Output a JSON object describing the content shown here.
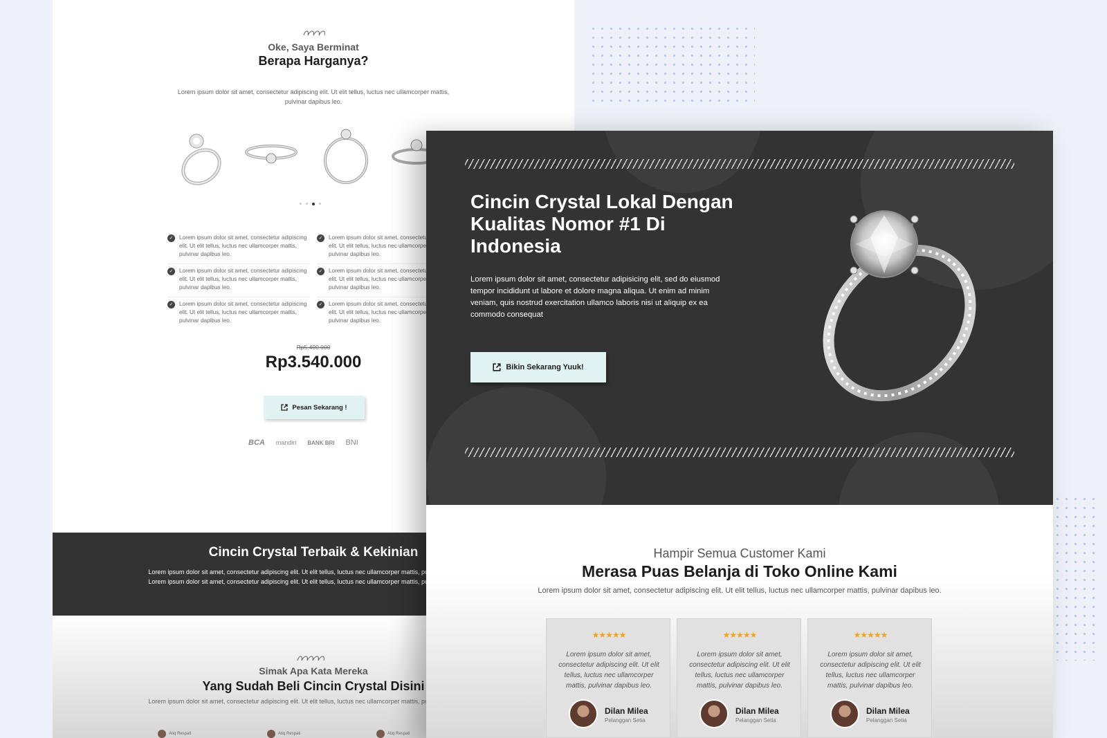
{
  "back_page": {
    "pricing_section": {
      "subtitle": "Oke, Saya Berminat",
      "title": "Berapa Harganya?",
      "description": "Lorem ipsum dolor sit amet, consectetur adipiscing elit. Ut elit tellus, luctus nec ullamcorper mattis, pulvinar dapibus leo.",
      "carousel_active_index": 2,
      "carousel_dot_count": 4,
      "features": [
        "Lorem ipsum dolor sit amet, consectetur adipiscing elit. Ut elit tellus, luctus nec ullamcorper mattis, pulvinar dapibus leo.",
        "Lorem ipsum dolor sit amet, consectetur adipiscing elit. Ut elit tellus, luctus nec ullamcorper mattis, pulvinar dapibus leo.",
        "Lorem ipsum dolor sit amet, consectetur adipiscing elit. Ut elit tellus, luctus nec ullamcorper mattis, pulvinar dapibus leo.",
        "Lorem ipsum dolor sit amet, consectetur adipiscing elit. Ut elit tellus, luctus nec ullamcorper mattis, pulvinar dapibus leo.",
        "Lorem ipsum dolor sit amet, consectetur adipiscing elit. Ut elit tellus, luctus nec ullamcorper mattis, pulvinar dapibus leo.",
        "Lorem ipsum dolor sit amet, consectetur adipiscing elit. Ut elit tellus, luctus nec ullamcorper mattis, pulvinar dapibus leo."
      ],
      "old_price": "Rp5.400.000",
      "price": "Rp3.540.000",
      "order_button": "Pesan Sekarang !",
      "banks": [
        "BCA",
        "mandiri",
        "BANK BRI",
        "BNI"
      ]
    },
    "dark_band": {
      "title": "Cincin Crystal Terbaik & Kekinian",
      "text": "Lorem ipsum dolor sit amet, consectetur adipiscing elit. Ut elit tellus, luctus nec ullamcorper mattis, pulvinar dapibus leo. Lorem ipsum dolor sit amet, consectetur adipiscing elit. Ut elit tellus, luctus nec ullamcorper mattis, pulvinar dapibus leo."
    },
    "testimonial_section": {
      "subtitle": "Simak Apa Kata Mereka",
      "title": "Yang Sudah Beli Cincin Crystal Disini",
      "description": "Lorem ipsum dolor sit amet, consectetur adipiscing elit. Ut elit tellus, luctus nec ullamcorper mattis, pulvinar dapibus leo.",
      "chat_names": [
        "Atiq Respati",
        "Atiq Respati",
        "Atiq Respati"
      ]
    }
  },
  "front_page": {
    "hero": {
      "title": "Cincin Crystal Lokal Dengan Kualitas Nomor #1 Di Indonesia",
      "text": "Lorem ipsum dolor sit amet, consectetur adipisicing elit, sed do eiusmod tempor incididunt ut labore et dolore magna aliqua. Ut enim ad minim veniam, quis nostrud exercitation ullamco laboris nisi ut aliquip ex ea commodo consequat",
      "button": "Bikin Sekarang Yuuk!"
    },
    "testimonials": {
      "subtitle": "Hampir Semua Customer Kami",
      "title": "Merasa Puas Belanja di Toko Online Kami",
      "description": "Lorem ipsum dolor sit amet, consectetur adipiscing elit. Ut elit tellus, luctus nec ullamcorper mattis, pulvinar dapibus leo.",
      "cards": [
        {
          "stars": "★★★★★",
          "text": "Lorem ipsum dolor sit amet, consectetur adipiscing elit. Ut elit tellus, luctus nec ullamcorper mattis, pulvinar dapibus leo.",
          "name": "Dilan Milea",
          "role": "Pelanggan Setia"
        },
        {
          "stars": "★★★★★",
          "text": "Lorem ipsum dolor sit amet, consectetur adipiscing elit. Ut elit tellus, luctus nec ullamcorper mattis, pulvinar dapibus leo.",
          "name": "Dilan Milea",
          "role": "Pelanggan Setia"
        },
        {
          "stars": "★★★★★",
          "text": "Lorem ipsum dolor sit amet, consectetur adipiscing elit. Ut elit tellus, luctus nec ullamcorper mattis, pulvinar dapibus leo.",
          "name": "Dilan Milea",
          "role": "Pelanggan Setia"
        }
      ]
    }
  },
  "icons": {
    "check": "check-circle-icon",
    "external": "external-link-icon",
    "star": "star-icon"
  },
  "colors": {
    "dark": "#333333",
    "button": "#e0f2f2",
    "star": "#f2a516",
    "accent_dots": "#b9c6ee"
  }
}
